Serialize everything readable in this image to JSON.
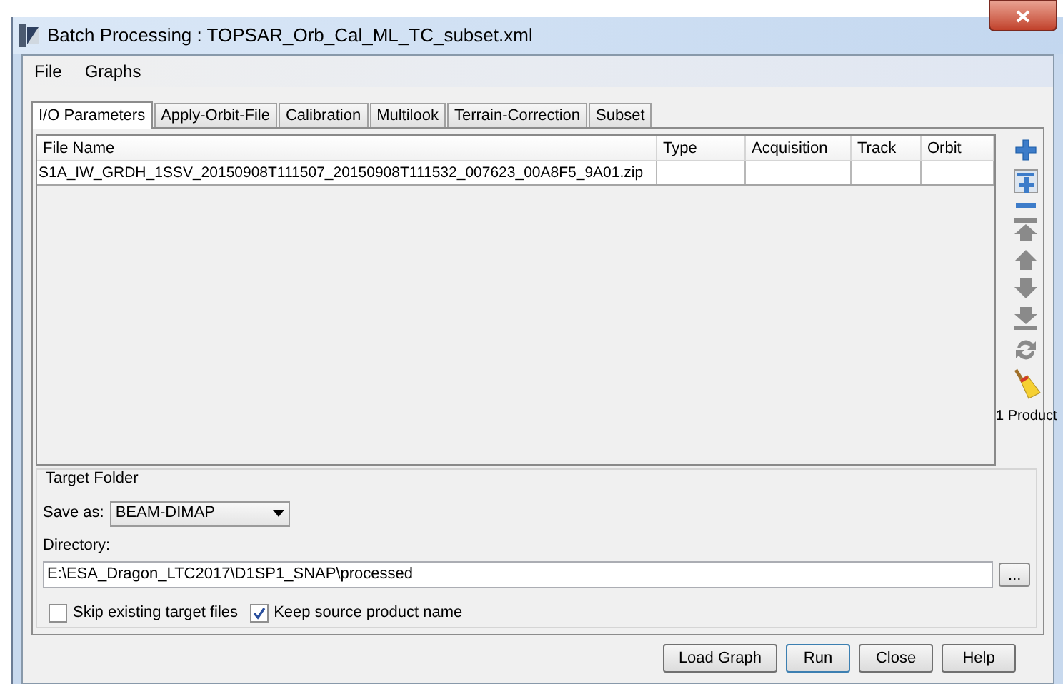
{
  "window": {
    "title": "Batch Processing : TOPSAR_Orb_Cal_ML_TC_subset.xml"
  },
  "menu": [
    "File",
    "Graphs"
  ],
  "tabs": [
    {
      "label": "I/O Parameters",
      "selected": true
    },
    {
      "label": "Apply-Orbit-File",
      "selected": false
    },
    {
      "label": "Calibration",
      "selected": false
    },
    {
      "label": "Multilook",
      "selected": false
    },
    {
      "label": "Terrain-Correction",
      "selected": false
    },
    {
      "label": "Subset",
      "selected": false
    }
  ],
  "table": {
    "columns": [
      "File Name",
      "Type",
      "Acquisition",
      "Track",
      "Orbit"
    ],
    "rows": [
      [
        "S1A_IW_GRDH_1SSV_20150908T111507_20150908T111532_007623_00A8F5_9A01.zip",
        "",
        "",
        "",
        ""
      ]
    ]
  },
  "toolbar": [
    {
      "kind": "add",
      "disabled": false
    },
    {
      "kind": "add-opened",
      "disabled": false
    },
    {
      "kind": "remove",
      "disabled": false
    },
    {
      "kind": "top",
      "disabled": true
    },
    {
      "kind": "up",
      "disabled": true
    },
    {
      "kind": "down",
      "disabled": true
    },
    {
      "kind": "bottom",
      "disabled": true
    },
    {
      "kind": "refresh",
      "disabled": true
    },
    {
      "kind": "clear",
      "disabled": false
    }
  ],
  "product_count": "1 Product",
  "target_folder": {
    "title": "Target Folder",
    "save_as_label": "Save as:",
    "save_as": "BEAM-DIMAP",
    "directory_label": "Directory:",
    "directory": "E:\\ESA_Dragon_LTC2017\\D1SP1_SNAP\\processed",
    "browse": "...",
    "options": [
      {
        "label": "Skip existing target files",
        "checked": false
      },
      {
        "label": "Keep source product name",
        "checked": true
      }
    ]
  },
  "buttons": [
    "Load Graph",
    "Run",
    "Close",
    "Help"
  ]
}
